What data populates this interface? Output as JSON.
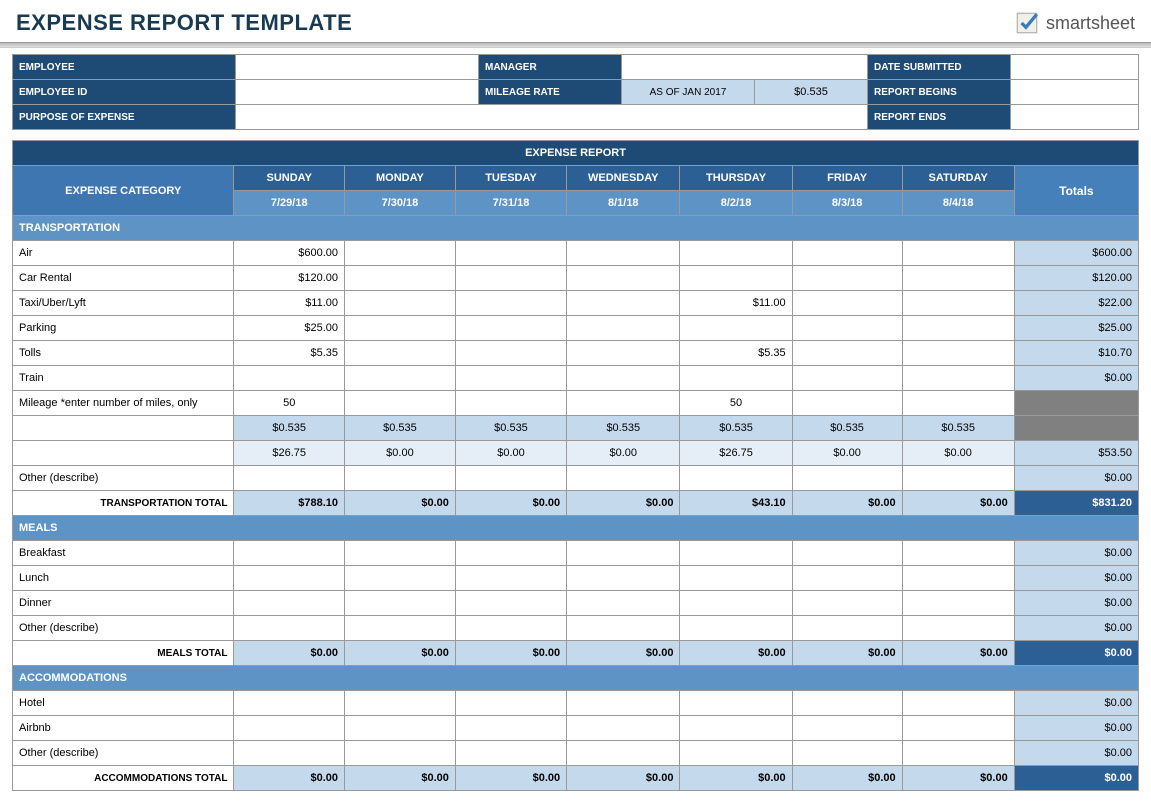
{
  "title": "EXPENSE REPORT TEMPLATE",
  "logo": "smartsheet",
  "info": {
    "employee_lbl": "EMPLOYEE",
    "employee": "",
    "manager_lbl": "MANAGER",
    "manager": "",
    "date_submitted_lbl": "DATE SUBMITTED",
    "date_submitted": "",
    "employee_id_lbl": "EMPLOYEE ID",
    "employee_id": "",
    "mileage_rate_lbl": "MILEAGE RATE",
    "mileage_asof": "AS OF JAN 2017",
    "mileage_rate": "$0.535",
    "report_begins_lbl": "REPORT BEGINS",
    "report_begins": "",
    "purpose_lbl": "PURPOSE OF EXPENSE",
    "purpose": "",
    "report_ends_lbl": "REPORT ENDS",
    "report_ends": ""
  },
  "report_title": "EXPENSE REPORT",
  "cat_lbl": "EXPENSE CATEGORY",
  "totals_lbl": "Totals",
  "days": [
    "SUNDAY",
    "MONDAY",
    "TUESDAY",
    "WEDNESDAY",
    "THURSDAY",
    "FRIDAY",
    "SATURDAY"
  ],
  "dates": [
    "7/29/18",
    "7/30/18",
    "7/31/18",
    "8/1/18",
    "8/2/18",
    "8/3/18",
    "8/4/18"
  ],
  "sections": [
    {
      "name": "TRANSPORTATION",
      "rows": [
        {
          "label": "Air",
          "v": [
            "$600.00",
            "",
            "",
            "",
            "",
            "",
            ""
          ],
          "t": "$600.00"
        },
        {
          "label": "Car Rental",
          "v": [
            "$120.00",
            "",
            "",
            "",
            "",
            "",
            ""
          ],
          "t": "$120.00"
        },
        {
          "label": "Taxi/Uber/Lyft",
          "v": [
            "$11.00",
            "",
            "",
            "",
            "$11.00",
            "",
            ""
          ],
          "t": "$22.00"
        },
        {
          "label": "Parking",
          "v": [
            "$25.00",
            "",
            "",
            "",
            "",
            "",
            ""
          ],
          "t": "$25.00"
        },
        {
          "label": "Tolls",
          "v": [
            "$5.35",
            "",
            "",
            "",
            "$5.35",
            "",
            ""
          ],
          "t": "$10.70"
        },
        {
          "label": "Train",
          "v": [
            "",
            "",
            "",
            "",
            "",
            "",
            ""
          ],
          "t": "$0.00"
        },
        {
          "label": "Mileage *enter number of miles, only",
          "v": [
            "50",
            "",
            "",
            "",
            "50",
            "",
            ""
          ],
          "t": "",
          "gry": true,
          "center": true
        },
        {
          "label": "",
          "v": [
            "$0.535",
            "$0.535",
            "$0.535",
            "$0.535",
            "$0.535",
            "$0.535",
            "$0.535"
          ],
          "t": "",
          "gry": true,
          "lt": true
        },
        {
          "label": "",
          "v": [
            "$26.75",
            "$0.00",
            "$0.00",
            "$0.00",
            "$26.75",
            "$0.00",
            "$0.00"
          ],
          "t": "$53.50",
          "lt2": true
        },
        {
          "label": "Other (describe)",
          "v": [
            "",
            "",
            "",
            "",
            "",
            "",
            ""
          ],
          "t": "$0.00"
        }
      ],
      "total_lbl": "TRANSPORTATION TOTAL",
      "totals": [
        "$788.10",
        "$0.00",
        "$0.00",
        "$0.00",
        "$43.10",
        "$0.00",
        "$0.00"
      ],
      "grand": "$831.20"
    },
    {
      "name": "MEALS",
      "rows": [
        {
          "label": "Breakfast",
          "v": [
            "",
            "",
            "",
            "",
            "",
            "",
            ""
          ],
          "t": "$0.00"
        },
        {
          "label": "Lunch",
          "v": [
            "",
            "",
            "",
            "",
            "",
            "",
            ""
          ],
          "t": "$0.00"
        },
        {
          "label": "Dinner",
          "v": [
            "",
            "",
            "",
            "",
            "",
            "",
            ""
          ],
          "t": "$0.00"
        },
        {
          "label": "Other (describe)",
          "v": [
            "",
            "",
            "",
            "",
            "",
            "",
            ""
          ],
          "t": "$0.00"
        }
      ],
      "total_lbl": "MEALS TOTAL",
      "totals": [
        "$0.00",
        "$0.00",
        "$0.00",
        "$0.00",
        "$0.00",
        "$0.00",
        "$0.00"
      ],
      "grand": "$0.00"
    },
    {
      "name": "ACCOMMODATIONS",
      "rows": [
        {
          "label": "Hotel",
          "v": [
            "",
            "",
            "",
            "",
            "",
            "",
            ""
          ],
          "t": "$0.00"
        },
        {
          "label": "Airbnb",
          "v": [
            "",
            "",
            "",
            "",
            "",
            "",
            ""
          ],
          "t": "$0.00"
        },
        {
          "label": "Other (describe)",
          "v": [
            "",
            "",
            "",
            "",
            "",
            "",
            ""
          ],
          "t": "$0.00"
        }
      ],
      "total_lbl": "ACCOMMODATIONS TOTAL",
      "totals": [
        "$0.00",
        "$0.00",
        "$0.00",
        "$0.00",
        "$0.00",
        "$0.00",
        "$0.00"
      ],
      "grand": "$0.00"
    }
  ]
}
